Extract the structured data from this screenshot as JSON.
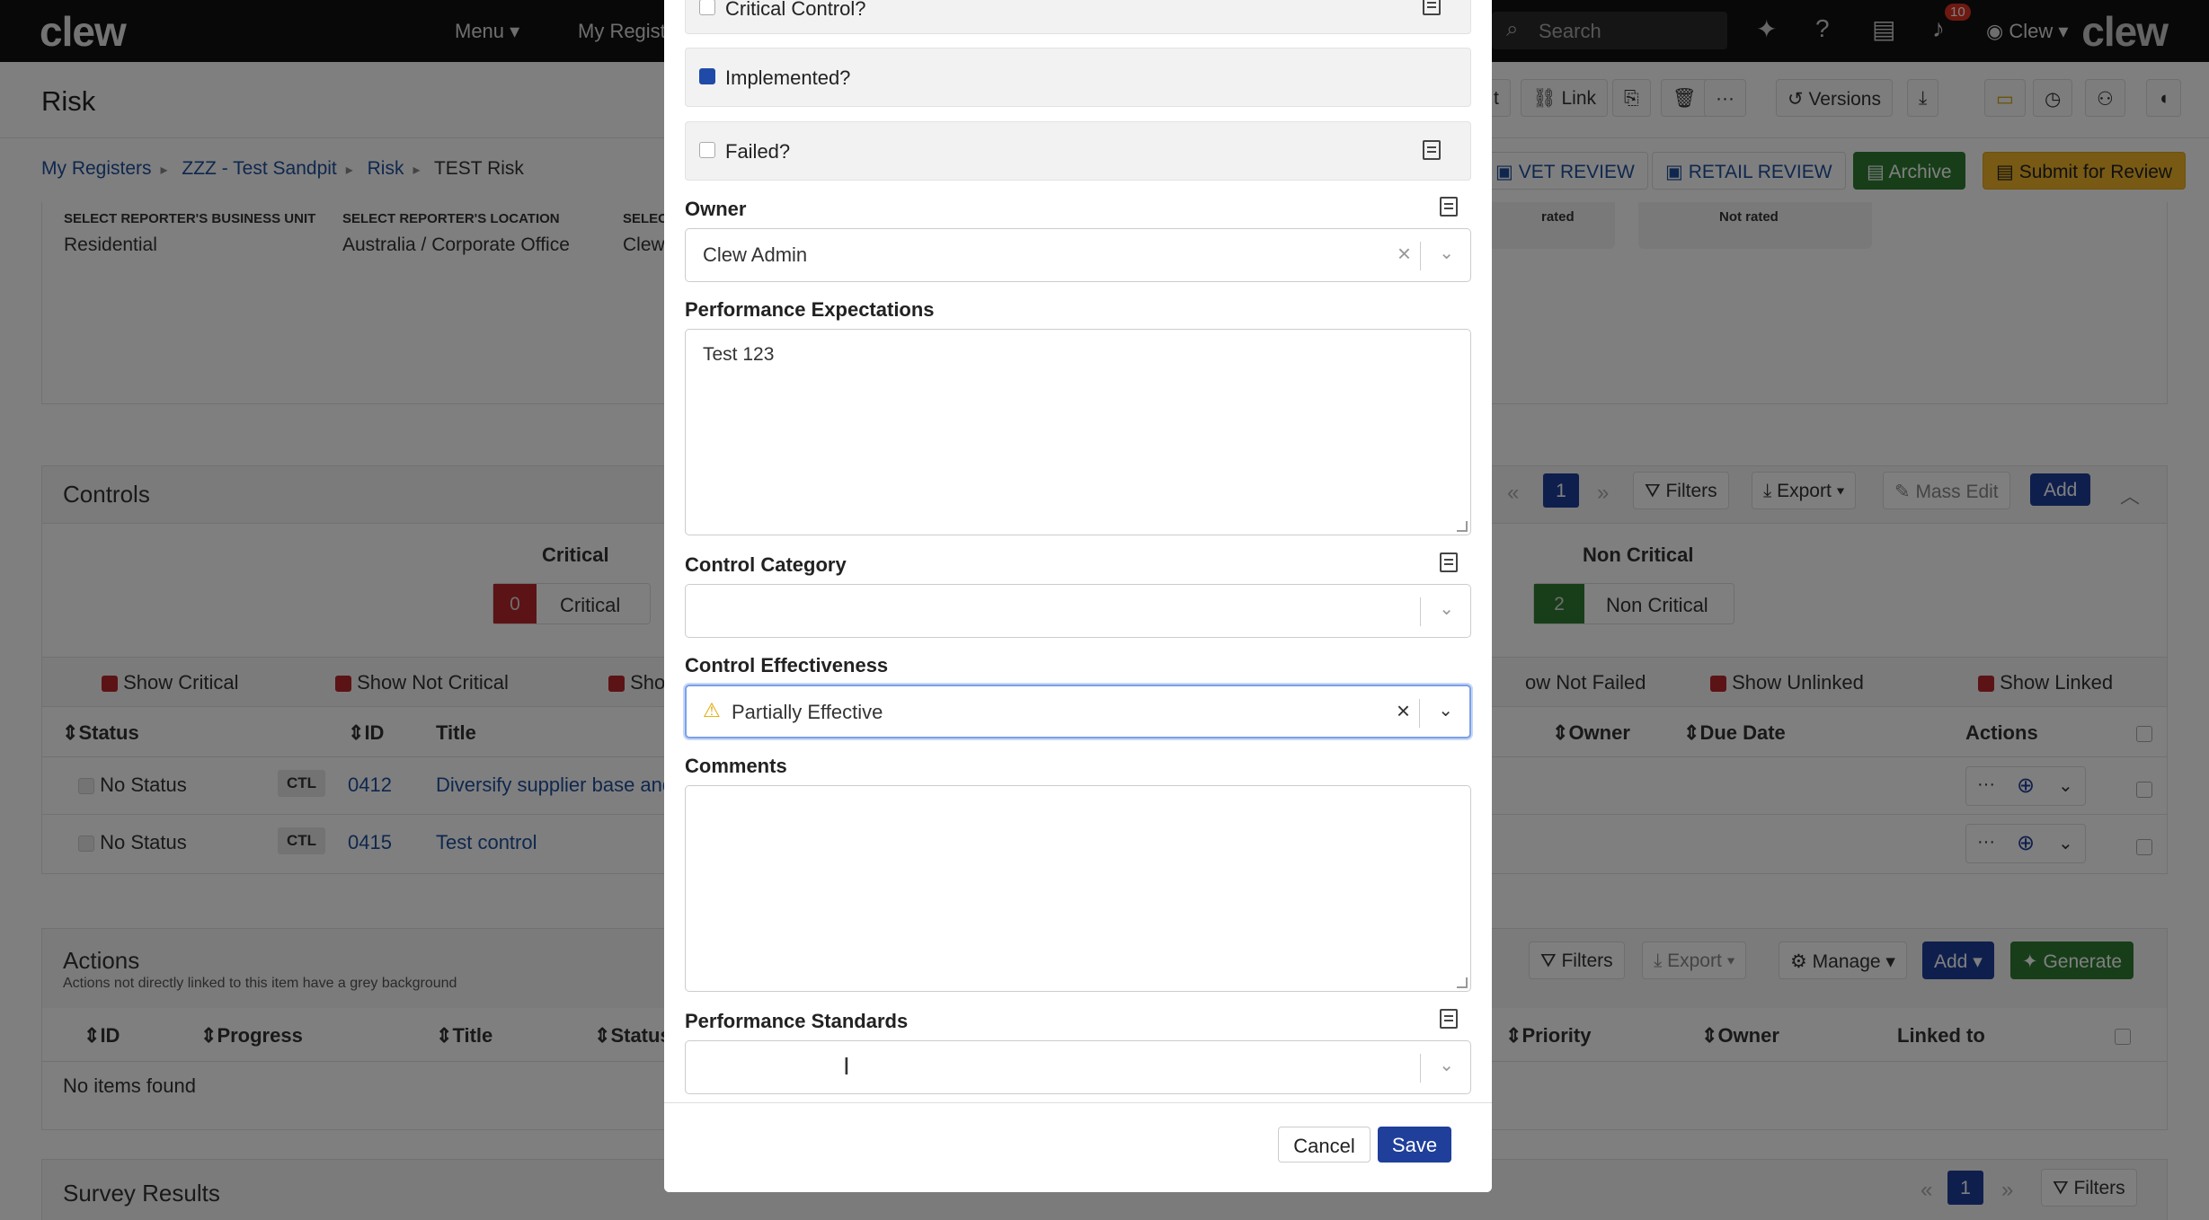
{
  "nav": {
    "logo": "clew",
    "menu_label": "Menu ▾",
    "registers_label": "My Regist",
    "search_placeholder": "Search",
    "notifications_count": "10",
    "user_label": "Clew ▾"
  },
  "page": {
    "title": "Risk",
    "toolbar": {
      "t_label": "t",
      "link_label": "Link",
      "versions_label": "Versions"
    },
    "breadcrumb": [
      "My Registers",
      "ZZZ - Test Sandpit",
      "Risk",
      "TEST Risk"
    ],
    "review_buttons": {
      "vet": "VET REVIEW",
      "retail": "RETAIL REVIEW",
      "archive": "Archive",
      "submit": "Submit for Review"
    },
    "reporter": {
      "bu_label": "SELECT REPORTER'S BUSINESS UNIT",
      "bu_value": "Residential",
      "loc_label": "SELECT REPORTER'S LOCATION",
      "loc_value": "Australia / Corporate Office",
      "sel_label": "SELEC",
      "sel_value": "Clew",
      "rated1": "rated",
      "rated2": "Not rated"
    }
  },
  "controls": {
    "title": "Controls",
    "page": "1",
    "filters": "Filters",
    "export": "Export ▾",
    "mass_edit": "Mass Edit",
    "add": "Add",
    "critical_heading": "Critical",
    "critical_count": "0",
    "critical_label": "Critical",
    "noncritical_heading": "Non Critical",
    "noncritical_count": "2",
    "noncritical_label": "Non Critical",
    "filters_row": [
      "Show Critical",
      "Show Not Critical",
      "Sho",
      "ow Not Failed",
      "Show Unlinked",
      "Show Linked"
    ],
    "columns": {
      "status": "Status",
      "id": "ID",
      "title": "Title",
      "owner": "Owner",
      "due": "Due Date",
      "actions": "Actions"
    },
    "rows": [
      {
        "status": "No Status",
        "type": "CTL",
        "id": "0412",
        "title": "Diversify supplier base and"
      },
      {
        "status": "No Status",
        "type": "CTL",
        "id": "0415",
        "title": "Test control"
      }
    ]
  },
  "actions_panel": {
    "title": "Actions",
    "subtitle": "Actions not directly linked to this item have a grey background",
    "filters": "Filters",
    "export": "Export ▾",
    "manage": "Manage ▾",
    "add": "Add ▾",
    "generate": "Generate",
    "columns": {
      "id": "ID",
      "progress": "Progress",
      "title": "Title",
      "status": "Status",
      "priority": "Priority",
      "owner": "Owner",
      "linked": "Linked to"
    },
    "empty": "No items found"
  },
  "survey": {
    "title": "Survey Results",
    "page": "1",
    "filters": "Filters"
  },
  "modal": {
    "critical_control_label": "Critical Control?",
    "implemented_label": "Implemented?",
    "failed_label": "Failed?",
    "owner_label": "Owner",
    "owner_value": "Clew Admin",
    "perf_exp_label": "Performance Expectations",
    "perf_exp_value": "Test 123",
    "category_label": "Control Category",
    "category_value": "",
    "effectiveness_label": "Control Effectiveness",
    "effectiveness_value": "Partially Effective",
    "comments_label": "Comments",
    "comments_value": "",
    "perf_std_label": "Performance Standards",
    "perf_std_value": "",
    "cancel": "Cancel",
    "save": "Save"
  }
}
